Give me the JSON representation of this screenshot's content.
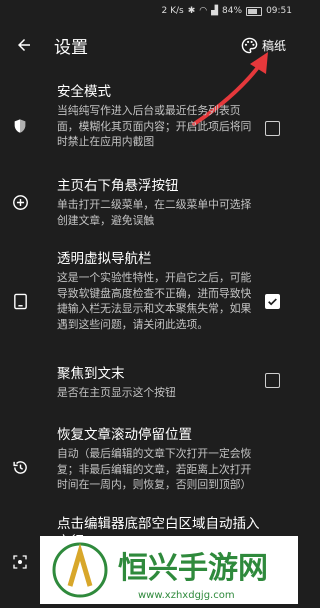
{
  "status": {
    "speed": "2 K/s",
    "battery": "84%",
    "time": "09:51"
  },
  "appbar": {
    "title": "设置",
    "theme_label": "稿纸"
  },
  "settings": [
    {
      "title": "安全模式",
      "desc": "当纯纯写作进入后台或最近任务列表页面，模糊化其页面内容；开启此项后将同时禁止在应用内截图",
      "checked": false
    },
    {
      "title": "主页右下角悬浮按钮",
      "desc": "单击打开二级菜单，在二级菜单中可选择创建文章，避免误触",
      "checked": null
    },
    {
      "title": "透明虚拟导航栏",
      "desc": "这是一个实验性特性，开启它之后，可能导致软键盘高度检查不正确，进而导致快捷输入栏无法显示和文本聚焦失常，如果遇到这些问题，请关闭此选项。",
      "checked": true
    },
    {
      "title": "聚焦到文末",
      "desc": "是否在主页显示这个按钮",
      "checked": false
    },
    {
      "title": "恢复文章滚动停留位置",
      "desc": "自动（最后编辑的文章下次打开一定会恢复；非最后编辑的文章，若距离上次打开时间在一周内，则恢复，否则回到顶部）",
      "checked": null
    },
    {
      "title": "点击编辑器底部空白区域自动插入空行",
      "desc": "",
      "checked": null
    }
  ],
  "watermark": {
    "text": "恒兴手游网",
    "url": "www.xzhxdgjg.com"
  },
  "colors": {
    "background": "#1e1e1e",
    "text": "#ffffff",
    "secondary": "#c4c4c4",
    "arrow": "#e5383b"
  },
  "icons": [
    "arrow-left-icon",
    "palette-icon",
    "shield-icon",
    "plus-circle-icon",
    "tablet-icon",
    "history-icon",
    "scan-icon"
  ]
}
